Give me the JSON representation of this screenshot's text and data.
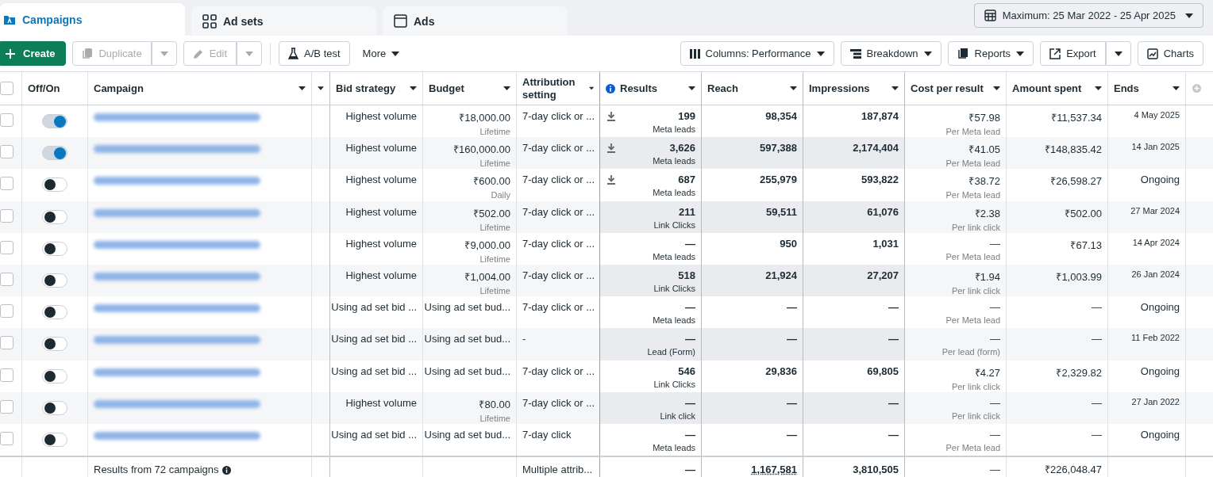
{
  "tabs": [
    {
      "label": "Campaigns",
      "selected": true
    },
    {
      "label": "Ad sets",
      "selected": false
    },
    {
      "label": "Ads",
      "selected": false
    }
  ],
  "date_range": "Maximum: 25 Mar 2022 - 25 Apr 2025",
  "toolbar": {
    "create": "Create",
    "duplicate": {
      "label": "Duplicate",
      "disabled": true
    },
    "edit": {
      "label": "Edit",
      "disabled": true
    },
    "ab_test": "A/B test",
    "more": "More",
    "columns": "Columns: Performance",
    "breakdown": "Breakdown",
    "reports": "Reports",
    "export": "Export",
    "charts": "Charts"
  },
  "select_all_checked": false,
  "columns": [
    "Off/On",
    "Campaign",
    "Bid strategy",
    "Budget",
    "Attribution setting",
    "Results",
    "Reach",
    "Impressions",
    "Cost per result",
    "Amount spent",
    "Ends"
  ],
  "rows": [
    {
      "checked": false,
      "on": true,
      "bid": "Highest volume",
      "budget": "₹18,000.00",
      "budget_type": "Lifetime",
      "attribution": "7-day click or ...",
      "results": "199",
      "results_type": "Meta leads",
      "download": true,
      "reach": "98,354",
      "impressions": "187,874",
      "cost": "₹57.98",
      "cost_type": "Per Meta lead",
      "spent": "₹11,537.34",
      "ends": "4 May 2025",
      "kind": "date"
    },
    {
      "checked": false,
      "on": true,
      "bid": "Highest volume",
      "budget": "₹160,000.00",
      "budget_type": "Lifetime",
      "attribution": "7-day click or ...",
      "results": "3,626",
      "results_type": "Meta leads",
      "download": true,
      "reach": "597,388",
      "impressions": "2,174,404",
      "cost": "₹41.05",
      "cost_type": "Per Meta lead",
      "spent": "₹148,835.42",
      "ends": "14 Jan 2025",
      "kind": "date"
    },
    {
      "checked": false,
      "on": false,
      "bid": "Highest volume",
      "budget": "₹600.00",
      "budget_type": "Daily",
      "attribution": "7-day click or ...",
      "results": "687",
      "results_type": "Meta leads",
      "download": true,
      "reach": "255,979",
      "impressions": "593,822",
      "cost": "₹38.72",
      "cost_type": "Per Meta lead",
      "spent": "₹26,598.27",
      "ends": "Ongoing",
      "kind": "status"
    },
    {
      "checked": false,
      "on": false,
      "bid": "Highest volume",
      "budget": "₹502.00",
      "budget_type": "Lifetime",
      "attribution": "7-day click or ...",
      "results": "211",
      "results_type": "Link Clicks",
      "download": false,
      "reach": "59,511",
      "impressions": "61,076",
      "cost": "₹2.38",
      "cost_type": "Per link click",
      "spent": "₹502.00",
      "ends": "27 Mar 2024",
      "kind": "date"
    },
    {
      "checked": false,
      "on": false,
      "bid": "Highest volume",
      "budget": "₹9,000.00",
      "budget_type": "Lifetime",
      "attribution": "7-day click or ...",
      "results": "—",
      "results_type": "Meta leads",
      "download": false,
      "reach": "950",
      "impressions": "1,031",
      "cost": "—",
      "cost_type": "Per Meta lead",
      "spent": "₹67.13",
      "ends": "14 Apr 2024",
      "kind": "date"
    },
    {
      "checked": false,
      "on": false,
      "bid": "Highest volume",
      "budget": "₹1,004.00",
      "budget_type": "Lifetime",
      "attribution": "7-day click or ...",
      "results": "518",
      "results_type": "Link Clicks",
      "download": false,
      "reach": "21,924",
      "impressions": "27,207",
      "cost": "₹1.94",
      "cost_type": "Per link click",
      "spent": "₹1,003.99",
      "ends": "26 Jan 2024",
      "kind": "date"
    },
    {
      "checked": false,
      "on": false,
      "bid": "Using ad set bid ...",
      "budget": "Using ad set bud...",
      "attribution": "7-day click or ...",
      "results": "—",
      "results_type": "Meta leads",
      "download": false,
      "reach": "—",
      "impressions": "—",
      "cost": "—",
      "cost_type": "Per Meta lead",
      "spent": "—",
      "ends": "Ongoing",
      "kind": "status"
    },
    {
      "checked": false,
      "on": false,
      "bid": "Using ad set bid ...",
      "budget": "Using ad set bud...",
      "attribution": "-",
      "results": "—",
      "results_type": "Lead (Form)",
      "download": false,
      "reach": "—",
      "impressions": "—",
      "cost": "—",
      "cost_type": "Per lead (form)",
      "spent": "—",
      "ends": "11 Feb 2022",
      "kind": "date"
    },
    {
      "checked": false,
      "on": false,
      "bid": "Using ad set bid ...",
      "budget": "Using ad set bud...",
      "attribution": "7-day click or ...",
      "results": "546",
      "results_type": "Link Clicks",
      "download": false,
      "reach": "29,836",
      "impressions": "69,805",
      "cost": "₹4.27",
      "cost_type": "Per link click",
      "spent": "₹2,329.82",
      "ends": "Ongoing",
      "kind": "status"
    },
    {
      "checked": false,
      "on": false,
      "bid": "Highest volume",
      "budget": "₹80.00",
      "budget_type": "Lifetime",
      "attribution": "7-day click or ...",
      "results": "—",
      "results_type": "Link click",
      "download": false,
      "reach": "—",
      "impressions": "—",
      "cost": "—",
      "cost_type": "Per link click",
      "spent": "—",
      "ends": "27 Jan 2022",
      "kind": "date"
    },
    {
      "checked": false,
      "on": false,
      "bid": "Using ad set bid ...",
      "budget": "Using ad set bud...",
      "attribution": "7-day click",
      "results": "—",
      "results_type": "Meta leads",
      "download": false,
      "reach": "—",
      "impressions": "—",
      "cost": "—",
      "cost_type": "Per Meta lead",
      "spent": "—",
      "ends": "Ongoing",
      "kind": "status"
    }
  ],
  "footer": {
    "summary": "Results from 72 campaigns",
    "attribution": "Multiple attrib...",
    "results": "—",
    "reach": "1,167,581",
    "impressions": "3,810,505",
    "cost": "—",
    "spent": "₹226,048.47"
  }
}
